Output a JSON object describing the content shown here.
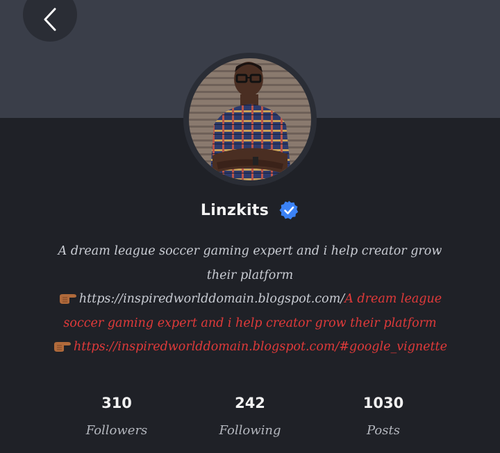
{
  "profile": {
    "name": "Linzkits",
    "verified": true
  },
  "bio": {
    "line1": "A dream league soccer gaming expert and i help creator grow",
    "line2": "their platform",
    "link1": "https://inspiredworlddomain.blogspot.com/",
    "red_text_a": "A dream league",
    "red_text_b": "soccer gaming expert and i help creator grow their platform",
    "link2": "https://inspiredworlddomain.blogspot.com/#google_vignette"
  },
  "stats": {
    "followers_count": "310",
    "followers_label": "Followers",
    "following_count": "242",
    "following_label": "Following",
    "posts_count": "1030",
    "posts_label": "Posts"
  },
  "icons": {
    "back": "chevron-left-icon",
    "verified": "verified-badge-icon",
    "hand": "pointing-hand-icon"
  },
  "colors": {
    "cover": "#3a3e49",
    "background": "#1f2127",
    "verified_blue": "#3b82f6",
    "red_text": "#e03a3a"
  }
}
